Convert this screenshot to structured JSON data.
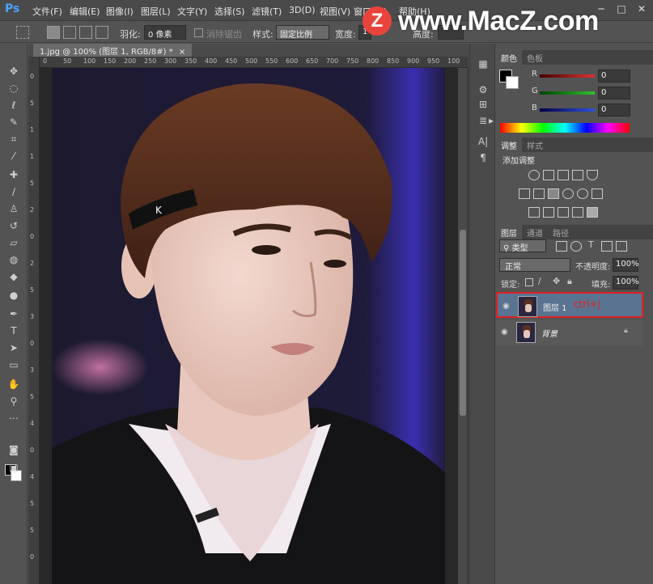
{
  "app": {
    "logo": "Ps"
  },
  "menu": [
    "文件(F)",
    "编辑(E)",
    "图像(I)",
    "图层(L)",
    "文字(Y)",
    "选择(S)",
    "滤镜(T)",
    "3D(D)",
    "视图(V)",
    "窗口(W)",
    "帮助(H)"
  ],
  "watermark": {
    "logo_letter": "Z",
    "text": "www.MacZ.com"
  },
  "window_controls": {
    "minimize": "─",
    "restore": "□",
    "close": "✕"
  },
  "options": {
    "feather_label": "羽化:",
    "feather_value": "0 像素",
    "antialias_label": "消除锯齿",
    "style_label": "样式:",
    "style_value": "固定比例",
    "width_label": "宽度:",
    "width_value": "1",
    "height_label": "高度:"
  },
  "document": {
    "tab_title": "1.jpg @ 100% (图层 1, RGB/8#) *",
    "tab_close": "×",
    "ruler_h": [
      "0",
      "50",
      "100",
      "150",
      "200",
      "250",
      "300",
      "350",
      "400",
      "450",
      "500",
      "550",
      "600",
      "650",
      "700",
      "750",
      "800",
      "850",
      "900",
      "950",
      "100"
    ],
    "ruler_v": [
      "0",
      "5",
      "1",
      "1",
      "5",
      "2",
      "0",
      "2",
      "5",
      "3",
      "0",
      "3",
      "5",
      "4",
      "0",
      "4",
      "5",
      "5",
      "0"
    ]
  },
  "color_panel": {
    "tabs": [
      "颜色",
      "色板"
    ],
    "channels": [
      {
        "label": "R",
        "value": "0",
        "color": "#e03030"
      },
      {
        "label": "G",
        "value": "0",
        "color": "#30c030"
      },
      {
        "label": "B",
        "value": "0",
        "color": "#3050e0"
      }
    ]
  },
  "adjust_panel": {
    "tabs": [
      "调整",
      "样式"
    ],
    "title": "添加调整"
  },
  "layers_panel": {
    "tabs": [
      "图层",
      "通道",
      "路径"
    ],
    "filter_value": "类型",
    "blend_mode": "正常",
    "opacity_label": "不透明度:",
    "opacity_value": "100%",
    "lock_label": "锁定:",
    "fill_label": "填充:",
    "fill_value": "100%",
    "layers": [
      {
        "name": "图层 1",
        "annotation": "ctrl+j",
        "selected": true
      },
      {
        "name": "背景",
        "locked": true,
        "selected": false
      }
    ]
  },
  "colors": {
    "accent_red": "#e02020",
    "selected_layer_bg": "#5a7391"
  }
}
